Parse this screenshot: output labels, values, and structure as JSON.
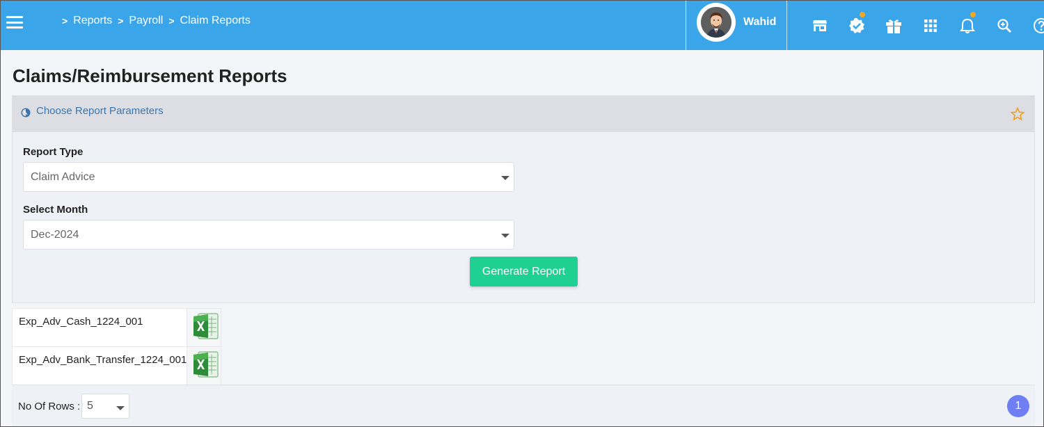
{
  "header": {
    "breadcrumb": [
      {
        "label": "Reports"
      },
      {
        "label": "Payroll"
      },
      {
        "label": "Claim Reports"
      }
    ],
    "breadcrumb_separator": ">",
    "user_name": "Wahid",
    "icons": [
      "store-icon",
      "verified-badge-icon",
      "gift-icon",
      "apps-grid-icon",
      "bell-icon",
      "search-zoom-icon",
      "help-icon"
    ],
    "accent_color": "#3aa5e8"
  },
  "page": {
    "title": "Claims/Reimbursement Reports"
  },
  "panel": {
    "title": "Choose Report Parameters",
    "report_type": {
      "label": "Report Type",
      "value": "Claim Advice"
    },
    "select_month": {
      "label": "Select Month",
      "value": "Dec-2024"
    },
    "generate_label": "Generate Report",
    "button_color": "#1ed092"
  },
  "files": [
    {
      "name": "Exp_Adv_Cash_1224_001",
      "icon": "excel-icon"
    },
    {
      "name": "Exp_Adv_Bank_Transfer_1224_001",
      "icon": "excel-icon"
    }
  ],
  "footer": {
    "rows_label": "No Of Rows :",
    "rows_value": "5",
    "current_page": "1"
  }
}
